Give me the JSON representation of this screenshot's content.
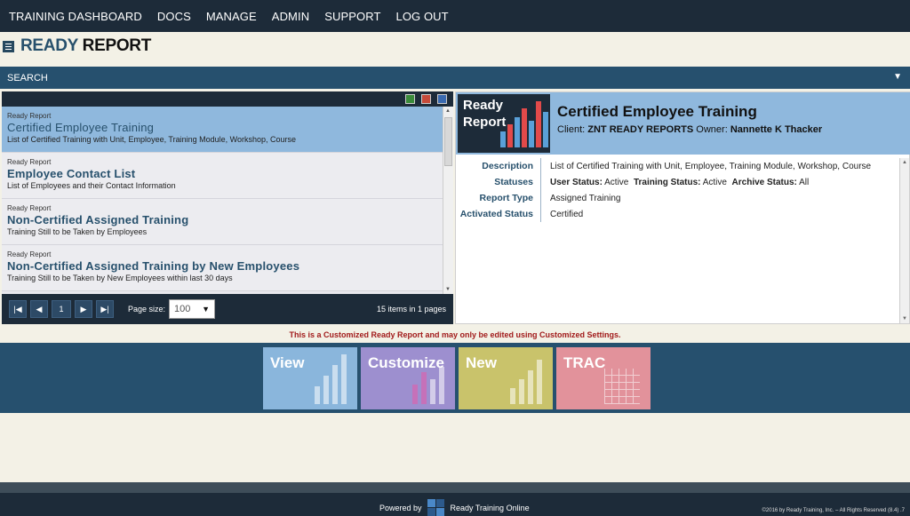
{
  "nav": {
    "items": [
      "TRAINING DASHBOARD",
      "DOCS",
      "MANAGE",
      "ADMIN",
      "SUPPORT",
      "LOG OUT"
    ]
  },
  "page": {
    "title_part1": "READY",
    "title_part2": "REPORT"
  },
  "search": {
    "label": "SEARCH"
  },
  "reports": [
    {
      "category": "Ready Report",
      "title": "Certified Employee Training",
      "description": "List of Certified Training with Unit, Employee, Training Module, Workshop, Course"
    },
    {
      "category": "Ready Report",
      "title": "Employee Contact List",
      "description": "List of Employees and their Contact Information"
    },
    {
      "category": "Ready Report",
      "title": "Non-Certified Assigned Training",
      "description": "Training Still to be Taken by Employees"
    },
    {
      "category": "Ready Report",
      "title": "Non-Certified Assigned Training by New Employees",
      "description": "Training Still to be Taken by New Employees within last 30 days"
    }
  ],
  "pager": {
    "current_page": "1",
    "page_size_label": "Page size:",
    "page_size": "100",
    "info": "15 items in 1 pages"
  },
  "detail": {
    "logo_line1": "Ready",
    "logo_line2": "Report",
    "title": "Certified Employee Training",
    "client_label": "Client:",
    "client": "ZNT READY REPORTS",
    "owner_label": "Owner:",
    "owner": "Nannette K Thacker",
    "rows": {
      "description_label": "Description",
      "description": "List of Certified Training with Unit, Employee, Training Module, Workshop, Course",
      "statuses_label": "Statuses",
      "user_status_label": "User Status:",
      "user_status": "Active",
      "training_status_label": "Training Status:",
      "training_status": "Active",
      "archive_status_label": "Archive Status:",
      "archive_status": "All",
      "report_type_label": "Report Type",
      "report_type": "Assigned Training",
      "activated_label": "Activated Status",
      "activated": "Certified"
    }
  },
  "notice": "This is a Customized Ready Report and may only be edited using Customized Settings.",
  "actions": {
    "view": "View",
    "customize": "Customize",
    "new": "New",
    "trac": "TRAC"
  },
  "colors": {
    "view": "#8ab6dc",
    "customize": "#9d8fcf",
    "new": "#c9c36b",
    "trac": "#e2929b"
  },
  "footer": {
    "powered_by": "Powered by",
    "brand": "Ready Training Online",
    "copyright": "©2016 by Ready Training, Inc. – All Rights Reserved (8.4) .7"
  }
}
